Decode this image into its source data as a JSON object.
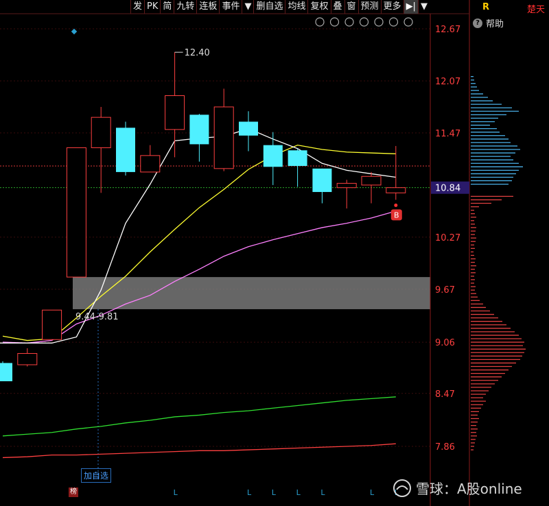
{
  "toolbar": {
    "items": [
      "发",
      "PK",
      "简",
      "九转",
      "连板",
      "事件",
      "删自选",
      "均线",
      "复权",
      "叠",
      "窗",
      "预测",
      "更多"
    ],
    "menu_arrow": "▼",
    "collapse_icon": "▶|",
    "dropdown_icon": "▼"
  },
  "right_panel": {
    "r_label": "R",
    "title": "楚天",
    "help_label": "帮助"
  },
  "add_watchlist_label": "加自选",
  "bang_label": "榜",
  "buy_marker": "B",
  "range_label": "9.44-9.81",
  "high_label": "12.40",
  "current_price_label": "10.84",
  "watermark": "雪球：A股online",
  "colors": {
    "up": "#ff4040",
    "down": "#4ff0ff",
    "ma5": "#ffffff",
    "ma10": "#ffff30",
    "ma20": "#ff80ff",
    "ma60": "#30e030",
    "ma120": "#ff4040",
    "axis_text": "#ff4040",
    "zone": "#888888"
  },
  "chart_data": {
    "type": "candlestick",
    "y_ticks": [
      "12.67",
      "12.07",
      "11.47",
      "10.84",
      "10.27",
      "9.67",
      "9.06",
      "8.47",
      "7.86"
    ],
    "ylim": [
      7.86,
      12.67
    ],
    "zone": [
      9.44,
      9.81
    ],
    "candles": [
      {
        "o": 8.82,
        "h": 8.84,
        "l": 8.61,
        "c": 8.61
      },
      {
        "o": 8.8,
        "h": 8.99,
        "l": 8.78,
        "c": 8.93
      },
      {
        "o": 9.09,
        "h": 9.43,
        "l": 9.08,
        "c": 9.43
      },
      {
        "o": 9.81,
        "h": 11.3,
        "l": 9.81,
        "c": 11.3
      },
      {
        "o": 11.3,
        "h": 11.77,
        "l": 10.78,
        "c": 11.65
      },
      {
        "o": 11.53,
        "h": 11.6,
        "l": 10.98,
        "c": 11.02
      },
      {
        "o": 11.02,
        "h": 11.33,
        "l": 11.02,
        "c": 11.21
      },
      {
        "o": 11.51,
        "h": 12.4,
        "l": 11.19,
        "c": 11.9
      },
      {
        "o": 11.68,
        "h": 11.69,
        "l": 11.14,
        "c": 11.34
      },
      {
        "o": 11.06,
        "h": 11.98,
        "l": 11.03,
        "c": 11.77
      },
      {
        "o": 11.6,
        "h": 11.72,
        "l": 11.26,
        "c": 11.44
      },
      {
        "o": 11.33,
        "h": 11.48,
        "l": 10.87,
        "c": 11.08
      },
      {
        "o": 11.27,
        "h": 11.29,
        "l": 10.85,
        "c": 11.09
      },
      {
        "o": 11.06,
        "h": 11.06,
        "l": 10.66,
        "c": 10.79
      },
      {
        "o": 10.84,
        "h": 10.93,
        "l": 10.6,
        "c": 10.89
      },
      {
        "o": 10.87,
        "h": 11.02,
        "l": 10.66,
        "c": 10.97
      },
      {
        "o": 10.78,
        "h": 11.32,
        "l": 10.7,
        "c": 10.84
      }
    ],
    "ma5": [
      null,
      null,
      9.05,
      9.12,
      9.66,
      10.43,
      10.88,
      11.38,
      11.41,
      11.43,
      11.52,
      11.4,
      11.29,
      11.12,
      11.04,
      11.0,
      10.96
    ],
    "ma10": [
      9.13,
      9.08,
      9.1,
      9.34,
      9.59,
      9.82,
      10.1,
      10.36,
      10.61,
      10.82,
      11.05,
      11.21,
      11.33,
      11.28,
      11.25,
      11.24,
      11.23
    ],
    "ma20": [
      9.06,
      9.05,
      9.08,
      9.27,
      9.37,
      9.5,
      9.6,
      9.76,
      9.9,
      10.05,
      10.16,
      10.24,
      10.31,
      10.38,
      10.43,
      10.49,
      10.57
    ],
    "ma60": [
      7.98,
      8.0,
      8.02,
      8.06,
      8.09,
      8.13,
      8.16,
      8.2,
      8.22,
      8.25,
      8.27,
      8.3,
      8.33,
      8.36,
      8.39,
      8.41,
      8.43
    ],
    "ma120": [
      7.73,
      7.74,
      7.76,
      7.76,
      7.77,
      7.78,
      7.79,
      7.8,
      7.81,
      7.81,
      7.82,
      7.83,
      7.84,
      7.85,
      7.86,
      7.87,
      7.89
    ],
    "volume_profile": [
      {
        "price": 12.12,
        "vol": 4,
        "side": "sup"
      },
      {
        "price": 12.08,
        "vol": 5,
        "side": "sup"
      },
      {
        "price": 12.04,
        "vol": 7,
        "side": "sup"
      },
      {
        "price": 12.0,
        "vol": 9,
        "side": "sup"
      },
      {
        "price": 11.96,
        "vol": 12,
        "side": "sup"
      },
      {
        "price": 11.92,
        "vol": 18,
        "side": "sup"
      },
      {
        "price": 11.88,
        "vol": 25,
        "side": "sup"
      },
      {
        "price": 11.84,
        "vol": 32,
        "side": "sup"
      },
      {
        "price": 11.8,
        "vol": 45,
        "side": "sup"
      },
      {
        "price": 11.76,
        "vol": 60,
        "side": "sup"
      },
      {
        "price": 11.72,
        "vol": 70,
        "side": "sup"
      },
      {
        "price": 11.68,
        "vol": 52,
        "side": "sup"
      },
      {
        "price": 11.64,
        "vol": 40,
        "side": "sup"
      },
      {
        "price": 11.6,
        "vol": 35,
        "side": "sup"
      },
      {
        "price": 11.56,
        "vol": 28,
        "side": "sup"
      },
      {
        "price": 11.52,
        "vol": 38,
        "side": "sup"
      },
      {
        "price": 11.48,
        "vol": 42,
        "side": "sup"
      },
      {
        "price": 11.44,
        "vol": 50,
        "side": "sup"
      },
      {
        "price": 11.4,
        "vol": 55,
        "side": "sup"
      },
      {
        "price": 11.36,
        "vol": 58,
        "side": "sup"
      },
      {
        "price": 11.32,
        "vol": 68,
        "side": "sup"
      },
      {
        "price": 11.28,
        "vol": 72,
        "side": "sup"
      },
      {
        "price": 11.24,
        "vol": 65,
        "side": "sup"
      },
      {
        "price": 11.2,
        "vol": 58,
        "side": "sup"
      },
      {
        "price": 11.16,
        "vol": 62,
        "side": "sup"
      },
      {
        "price": 11.12,
        "vol": 70,
        "side": "sup"
      },
      {
        "price": 11.08,
        "vol": 76,
        "side": "sup"
      },
      {
        "price": 11.04,
        "vol": 70,
        "side": "sup"
      },
      {
        "price": 11.0,
        "vol": 66,
        "side": "sup"
      },
      {
        "price": 10.96,
        "vol": 62,
        "side": "sup"
      },
      {
        "price": 10.92,
        "vol": 60,
        "side": "sup"
      },
      {
        "price": 10.88,
        "vol": 55,
        "side": "sup"
      },
      {
        "price": 10.74,
        "vol": 62,
        "side": "dem"
      },
      {
        "price": 10.7,
        "vol": 45,
        "side": "dem"
      },
      {
        "price": 10.66,
        "vol": 30,
        "side": "dem"
      },
      {
        "price": 10.62,
        "vol": 12,
        "side": "dem"
      },
      {
        "price": 10.58,
        "vol": 5,
        "side": "dem"
      },
      {
        "price": 10.54,
        "vol": 6,
        "side": "dem"
      },
      {
        "price": 10.5,
        "vol": 8,
        "side": "dem"
      },
      {
        "price": 10.46,
        "vol": 5,
        "side": "dem"
      },
      {
        "price": 10.42,
        "vol": 6,
        "side": "dem"
      },
      {
        "price": 10.38,
        "vol": 8,
        "side": "dem"
      },
      {
        "price": 10.34,
        "vol": 7,
        "side": "dem"
      },
      {
        "price": 10.3,
        "vol": 6,
        "side": "dem"
      },
      {
        "price": 10.26,
        "vol": 8,
        "side": "dem"
      },
      {
        "price": 10.22,
        "vol": 7,
        "side": "dem"
      },
      {
        "price": 10.18,
        "vol": 5,
        "side": "dem"
      },
      {
        "price": 10.14,
        "vol": 6,
        "side": "dem"
      },
      {
        "price": 10.1,
        "vol": 4,
        "side": "dem"
      },
      {
        "price": 10.06,
        "vol": 5,
        "side": "dem"
      },
      {
        "price": 10.02,
        "vol": 7,
        "side": "dem"
      },
      {
        "price": 9.98,
        "vol": 6,
        "side": "dem"
      },
      {
        "price": 9.94,
        "vol": 8,
        "side": "dem"
      },
      {
        "price": 9.9,
        "vol": 6,
        "side": "dem"
      },
      {
        "price": 9.86,
        "vol": 7,
        "side": "dem"
      },
      {
        "price": 9.82,
        "vol": 5,
        "side": "dem"
      },
      {
        "price": 9.78,
        "vol": 6,
        "side": "dem"
      },
      {
        "price": 9.74,
        "vol": 5,
        "side": "dem"
      },
      {
        "price": 9.7,
        "vol": 7,
        "side": "dem"
      },
      {
        "price": 9.66,
        "vol": 6,
        "side": "dem"
      },
      {
        "price": 9.62,
        "vol": 8,
        "side": "dem"
      },
      {
        "price": 9.58,
        "vol": 10,
        "side": "dem"
      },
      {
        "price": 9.54,
        "vol": 13,
        "side": "dem"
      },
      {
        "price": 9.5,
        "vol": 18,
        "side": "dem"
      },
      {
        "price": 9.46,
        "vol": 22,
        "side": "dem"
      },
      {
        "price": 9.42,
        "vol": 28,
        "side": "dem"
      },
      {
        "price": 9.38,
        "vol": 34,
        "side": "dem"
      },
      {
        "price": 9.34,
        "vol": 40,
        "side": "dem"
      },
      {
        "price": 9.3,
        "vol": 46,
        "side": "dem"
      },
      {
        "price": 9.26,
        "vol": 52,
        "side": "dem"
      },
      {
        "price": 9.22,
        "vol": 58,
        "side": "dem"
      },
      {
        "price": 9.18,
        "vol": 64,
        "side": "dem"
      },
      {
        "price": 9.14,
        "vol": 70,
        "side": "dem"
      },
      {
        "price": 9.1,
        "vol": 74,
        "side": "dem"
      },
      {
        "price": 9.06,
        "vol": 78,
        "side": "dem"
      },
      {
        "price": 9.02,
        "vol": 76,
        "side": "dem"
      },
      {
        "price": 8.98,
        "vol": 80,
        "side": "dem"
      },
      {
        "price": 8.94,
        "vol": 78,
        "side": "dem"
      },
      {
        "price": 8.9,
        "vol": 75,
        "side": "dem"
      },
      {
        "price": 8.86,
        "vol": 72,
        "side": "dem"
      },
      {
        "price": 8.82,
        "vol": 66,
        "side": "dem"
      },
      {
        "price": 8.78,
        "vol": 60,
        "side": "dem"
      },
      {
        "price": 8.74,
        "vol": 55,
        "side": "dem"
      },
      {
        "price": 8.7,
        "vol": 50,
        "side": "dem"
      },
      {
        "price": 8.66,
        "vol": 45,
        "side": "dem"
      },
      {
        "price": 8.62,
        "vol": 40,
        "side": "dem"
      },
      {
        "price": 8.58,
        "vol": 35,
        "side": "dem"
      },
      {
        "price": 8.54,
        "vol": 30,
        "side": "dem"
      },
      {
        "price": 8.5,
        "vol": 26,
        "side": "dem"
      },
      {
        "price": 8.46,
        "vol": 22,
        "side": "dem"
      },
      {
        "price": 8.42,
        "vol": 18,
        "side": "dem"
      },
      {
        "price": 8.38,
        "vol": 22,
        "side": "dem"
      },
      {
        "price": 8.34,
        "vol": 18,
        "side": "dem"
      },
      {
        "price": 8.3,
        "vol": 15,
        "side": "dem"
      },
      {
        "price": 8.26,
        "vol": 12,
        "side": "dem"
      },
      {
        "price": 8.22,
        "vol": 10,
        "side": "dem"
      },
      {
        "price": 8.18,
        "vol": 12,
        "side": "dem"
      },
      {
        "price": 8.14,
        "vol": 10,
        "side": "dem"
      },
      {
        "price": 8.1,
        "vol": 8,
        "side": "dem"
      },
      {
        "price": 8.06,
        "vol": 10,
        "side": "dem"
      },
      {
        "price": 8.02,
        "vol": 8,
        "side": "dem"
      },
      {
        "price": 7.98,
        "vol": 9,
        "side": "dem"
      },
      {
        "price": 7.94,
        "vol": 7,
        "side": "dem"
      },
      {
        "price": 7.9,
        "vol": 6,
        "side": "dem"
      },
      {
        "price": 7.86,
        "vol": 5,
        "side": "dem"
      },
      {
        "price": 7.82,
        "vol": 4,
        "side": "dem"
      }
    ],
    "bottom_markers": [
      "L",
      "L",
      "L",
      "L",
      "L",
      "L",
      "L"
    ]
  }
}
